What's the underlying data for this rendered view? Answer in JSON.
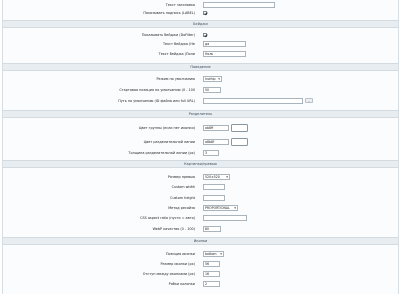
{
  "top": {
    "title_label": "Текст заголовка",
    "show_label_label": "Показывать подпись (LABEL)"
  },
  "sections": {
    "badges": "Бейджи",
    "behavior": "Поведение",
    "separator": "Разделитель",
    "thumbs": "Картинки/превью",
    "icons": "Иконки"
  },
  "badges": {
    "show_label": "Показывать бейджи (DoFilter)",
    "text_label": "Текст бейджа (Не",
    "text_value": "да",
    "text2_label": "Текст бейджа (Поли",
    "text2_value": "Ноль"
  },
  "behavior": {
    "mode_label": "Режим по умолчанию",
    "mode_value": "Inwhip",
    "start_label": "Стартовая позиция по умолчанию (0 - 100",
    "start_value": "50",
    "path_label": "Путь по умолчанию (ID файла или full URL)",
    "path_value": "",
    "path_btn": "..."
  },
  "separator": {
    "group_color_label": "Цвет группы (если нет иконки)",
    "group_color_value": "ab8ff",
    "line_color_label": "Цвет разделительной линии",
    "line_color_value": "a8b8f",
    "width_label": "Толщина разделительной линии (px)",
    "width_value": "3"
  },
  "thumbs": {
    "size_label": "Размер превью",
    "size_value": "520×520",
    "width_label": "Custom width",
    "width_value": "",
    "height_label": "Custom height",
    "height_value": "",
    "method_label": "Метод ресайза",
    "method_value": "PROPORTIONAL",
    "aspect_label": "CSS aspect ratio (пусто = авто)",
    "aspect_value": "",
    "webp_label": "WebP качество (0 - 100)",
    "webp_value": "80"
  },
  "icons": {
    "position_label": "Позиция иконки",
    "position_value": "bottom",
    "size_label": "Размер иконки (px)",
    "size_value": "56",
    "offset_label": "Отступ между иконками (px)",
    "offset_value": "16",
    "cols_label": "Рябки колонки",
    "cols_value": "2"
  }
}
